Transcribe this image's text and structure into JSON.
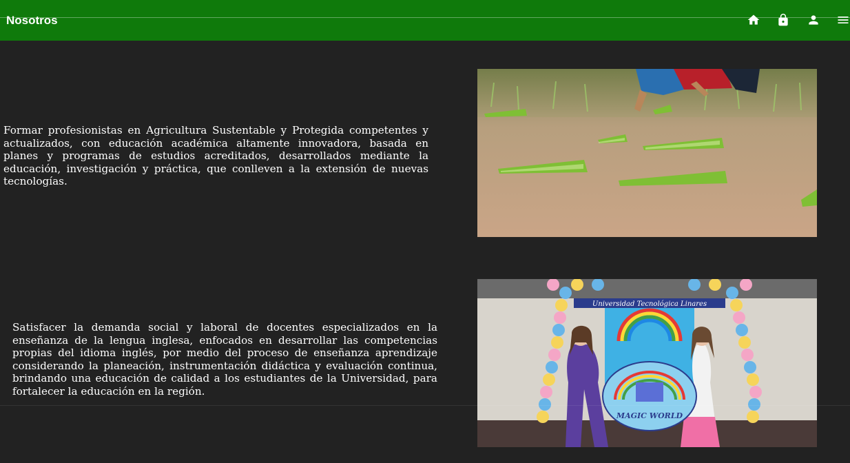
{
  "header": {
    "title": "Nosotros",
    "background_color": "#0f7a0b",
    "icons": [
      "home-icon",
      "lock-icon",
      "user-icon",
      "menu-icon"
    ]
  },
  "sections": [
    {
      "text": "Formar profesionistas en Agricultura Sustentable y Protegida competentes y actualizados, con educación académica altamente innovadora, basada en planes y programas de estudios acreditados, desarrollados mediante la educación, investigación y práctica, que conlleven a la extensión de nuevas tecnologías."
    },
    {
      "text": "Satisfacer la demanda social y laboral de docentes especializados en la enseñanza de la lengua inglesa, enfocados en desarrollar las competencias propias del idioma inglés, por medio del proceso de enseñanza aprendizaje considerando la planeación, instrumentación didáctica y evaluación continua, brindando una educación de calidad a los estudiantes de la Universidad, para fortalecer la educación en la región.",
      "photo_banner_text": "Universidad Tecnológica Linares",
      "photo_sign_text": "MAGIC WORLD"
    }
  ]
}
